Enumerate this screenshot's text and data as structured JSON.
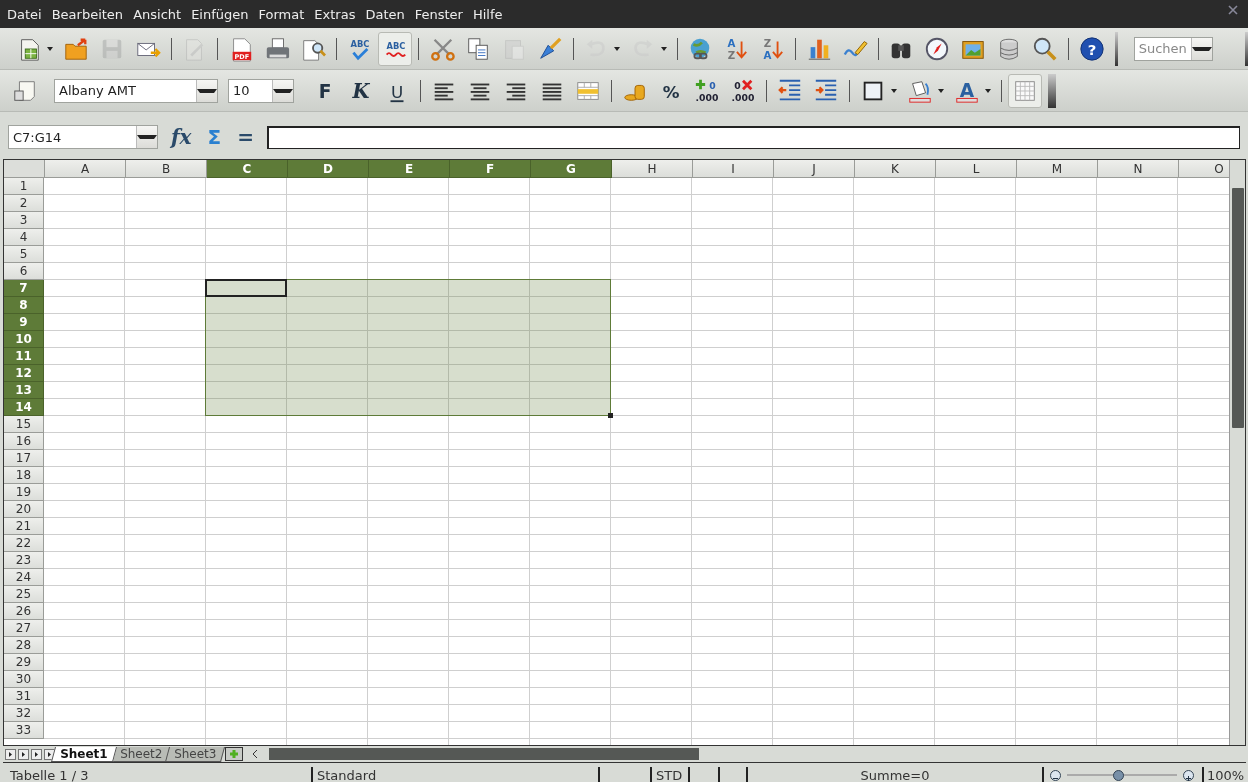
{
  "menu": [
    {
      "label": "Datei"
    },
    {
      "label": "Bearbeiten"
    },
    {
      "label": "Ansicht"
    },
    {
      "label": "Einfügen"
    },
    {
      "label": "Format"
    },
    {
      "label": "Extras"
    },
    {
      "label": "Daten"
    },
    {
      "label": "Fenster"
    },
    {
      "label": "Hilfe"
    }
  ],
  "standard_toolbar": [
    {
      "kind": "new",
      "dropdown": true
    },
    {
      "kind": "open"
    },
    {
      "kind": "save",
      "disabled": true
    },
    {
      "kind": "email"
    },
    {
      "kind": "sep"
    },
    {
      "kind": "edit",
      "disabled": true
    },
    {
      "kind": "sep"
    },
    {
      "kind": "pdf",
      "label": "PDF"
    },
    {
      "kind": "print"
    },
    {
      "kind": "preview"
    },
    {
      "kind": "sep"
    },
    {
      "kind": "spell",
      "label": "ABC"
    },
    {
      "kind": "autospell",
      "label": "ABC",
      "pressed": true
    },
    {
      "kind": "sep"
    },
    {
      "kind": "cut"
    },
    {
      "kind": "copy"
    },
    {
      "kind": "paste",
      "disabled": true
    },
    {
      "kind": "brush"
    },
    {
      "kind": "sep"
    },
    {
      "kind": "undo",
      "disabled": true,
      "dropdown": true
    },
    {
      "kind": "redo",
      "disabled": true,
      "dropdown": true
    },
    {
      "kind": "sep"
    },
    {
      "kind": "link"
    },
    {
      "kind": "sortasc",
      "label": "A",
      "label2": "Z"
    },
    {
      "kind": "sortdesc",
      "label": "Z",
      "label2": "A"
    },
    {
      "kind": "sep"
    },
    {
      "kind": "chart"
    },
    {
      "kind": "draw"
    },
    {
      "kind": "sep"
    },
    {
      "kind": "find"
    },
    {
      "kind": "navigator"
    },
    {
      "kind": "gallery"
    },
    {
      "kind": "database"
    },
    {
      "kind": "zoom"
    },
    {
      "kind": "sep"
    },
    {
      "kind": "help",
      "label": "?"
    }
  ],
  "search": {
    "placeholder": "Suchen"
  },
  "format_toolbar": {
    "font": "Albany AMT",
    "size": "10",
    "items": [
      {
        "kind": "bold",
        "label": "F"
      },
      {
        "kind": "italic",
        "label": "K"
      },
      {
        "kind": "underline",
        "label": "U"
      },
      {
        "kind": "sep"
      },
      {
        "kind": "left"
      },
      {
        "kind": "center"
      },
      {
        "kind": "right"
      },
      {
        "kind": "justify"
      },
      {
        "kind": "merge"
      },
      {
        "kind": "sep"
      },
      {
        "kind": "currency"
      },
      {
        "kind": "percent",
        "label": "%"
      },
      {
        "kind": "adddec",
        "label": "0",
        "label2": ".000"
      },
      {
        "kind": "deldec",
        "label": "0",
        "label2": ".000"
      },
      {
        "kind": "sep"
      },
      {
        "kind": "outdent"
      },
      {
        "kind": "indent"
      },
      {
        "kind": "sep"
      },
      {
        "kind": "border",
        "dropdown": true
      },
      {
        "kind": "bgcolor",
        "dropdown": true
      },
      {
        "kind": "fontcolor",
        "label": "A",
        "dropdown": true
      },
      {
        "kind": "sep"
      },
      {
        "kind": "grid",
        "pressed": true
      }
    ]
  },
  "formula_bar": {
    "name_box": "C7:G14",
    "function_label": "fx",
    "sum_label": "Σ",
    "equals_label": "="
  },
  "columns": [
    {
      "label": "A",
      "selected": false,
      "cursor": false
    },
    {
      "label": "B",
      "selected": false,
      "cursor": false
    },
    {
      "label": "C",
      "selected": true,
      "cursor": true
    },
    {
      "label": "D",
      "selected": true,
      "cursor": false
    },
    {
      "label": "E",
      "selected": true,
      "cursor": false
    },
    {
      "label": "F",
      "selected": true,
      "cursor": false
    },
    {
      "label": "G",
      "selected": true,
      "cursor": false
    },
    {
      "label": "H",
      "selected": false,
      "cursor": false
    },
    {
      "label": "I",
      "selected": false,
      "cursor": false
    },
    {
      "label": "J",
      "selected": false,
      "cursor": false
    },
    {
      "label": "K",
      "selected": false,
      "cursor": false
    },
    {
      "label": "L",
      "selected": false,
      "cursor": false
    },
    {
      "label": "M",
      "selected": false,
      "cursor": false
    },
    {
      "label": "N",
      "selected": false,
      "cursor": false
    },
    {
      "label": "O",
      "selected": false,
      "cursor": false
    }
  ],
  "rows": [
    {
      "label": "1",
      "selected": false,
      "cursor": false
    },
    {
      "label": "2",
      "selected": false,
      "cursor": false
    },
    {
      "label": "3",
      "selected": false,
      "cursor": false
    },
    {
      "label": "4",
      "selected": false,
      "cursor": false
    },
    {
      "label": "5",
      "selected": false,
      "cursor": false
    },
    {
      "label": "6",
      "selected": false,
      "cursor": false
    },
    {
      "label": "7",
      "selected": true,
      "cursor": true
    },
    {
      "label": "8",
      "selected": true,
      "cursor": false
    },
    {
      "label": "9",
      "selected": true,
      "cursor": false
    },
    {
      "label": "10",
      "selected": true,
      "cursor": false
    },
    {
      "label": "11",
      "selected": true,
      "cursor": false
    },
    {
      "label": "12",
      "selected": true,
      "cursor": false
    },
    {
      "label": "13",
      "selected": true,
      "cursor": false
    },
    {
      "label": "14",
      "selected": true,
      "cursor": false
    },
    {
      "label": "15",
      "selected": false,
      "cursor": false
    },
    {
      "label": "16",
      "selected": false,
      "cursor": false
    },
    {
      "label": "17",
      "selected": false,
      "cursor": false
    },
    {
      "label": "18",
      "selected": false,
      "cursor": false
    },
    {
      "label": "19",
      "selected": false,
      "cursor": false
    },
    {
      "label": "20",
      "selected": false,
      "cursor": false
    },
    {
      "label": "21",
      "selected": false,
      "cursor": false
    },
    {
      "label": "22",
      "selected": false,
      "cursor": false
    },
    {
      "label": "23",
      "selected": false,
      "cursor": false
    },
    {
      "label": "24",
      "selected": false,
      "cursor": false
    },
    {
      "label": "25",
      "selected": false,
      "cursor": false
    },
    {
      "label": "26",
      "selected": false,
      "cursor": false
    },
    {
      "label": "27",
      "selected": false,
      "cursor": false
    },
    {
      "label": "28",
      "selected": false,
      "cursor": false
    },
    {
      "label": "29",
      "selected": false,
      "cursor": false
    },
    {
      "label": "30",
      "selected": false,
      "cursor": false
    },
    {
      "label": "31",
      "selected": false,
      "cursor": false
    },
    {
      "label": "32",
      "selected": false,
      "cursor": false
    },
    {
      "label": "33",
      "selected": false,
      "cursor": false
    }
  ],
  "sheet_tabs": [
    {
      "label": "Sheet1",
      "selected": true
    },
    {
      "label": "Sheet2",
      "selected": false
    },
    {
      "label": "Sheet3",
      "selected": false
    }
  ],
  "status_bar": {
    "sheet": "Tabelle 1 / 3",
    "style": "Standard",
    "mode": "STD",
    "sum": "Summe=0",
    "zoom": {
      "level": 0.46,
      "reading": "100%"
    }
  }
}
